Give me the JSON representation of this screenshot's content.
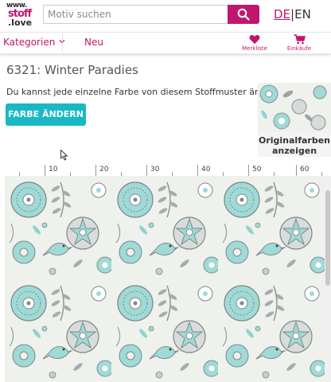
{
  "header": {
    "logo": {
      "line1": "www.",
      "line2": "stoff",
      "line3": ".love"
    },
    "search": {
      "placeholder": "Motiv suchen"
    },
    "lang": {
      "de": "DE",
      "sep": "|",
      "en": "EN"
    }
  },
  "nav": {
    "categories_label": "Kategorien",
    "new_label": "Neu",
    "wishlist_label": "Merkliste",
    "cart_label": "Einkäufe"
  },
  "product": {
    "title": "6321: Winter Paradies",
    "description": "Du kannst jede einzelne Farbe von diesem Stoffmuster ändern.",
    "change_color_button": "FARBE ÄNDERN",
    "original_colors_label": "Originalfarben anzeigen"
  },
  "ruler": {
    "labels": [
      "10",
      "20",
      "30",
      "40",
      "50",
      "60"
    ]
  },
  "colors": {
    "brand": "#c0176e",
    "accent": "#19b8c4",
    "pattern_bg": "#eef1ec",
    "pattern_aqua": "#8fd3d1",
    "pattern_grey": "#9ea3a2"
  },
  "icons": [
    "search-icon",
    "chevron-down-icon",
    "heart-icon",
    "cart-icon",
    "cursor-icon"
  ]
}
